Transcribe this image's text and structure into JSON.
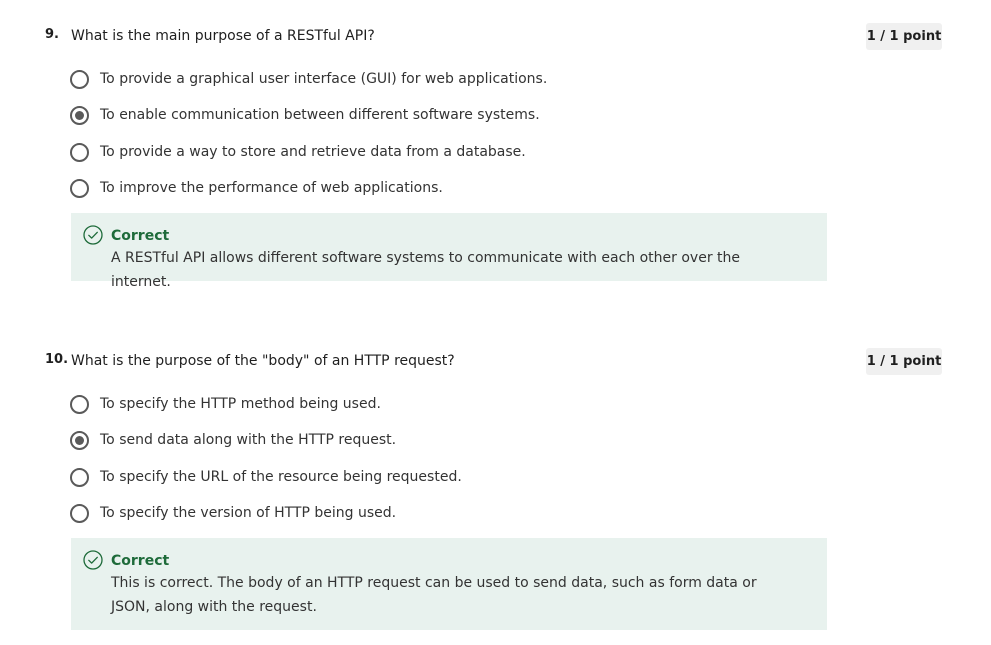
{
  "questions": [
    {
      "number": "9.",
      "text": "What is the main purpose of a RESTful API?",
      "points": "1 / 1 point",
      "options": [
        {
          "label": "To provide a graphical user interface (GUI) for web applications.",
          "selected": false
        },
        {
          "label": "To enable communication between different software systems.",
          "selected": true
        },
        {
          "label": "To provide a way to store and retrieve data from a database.",
          "selected": false
        },
        {
          "label": "To improve the performance of web applications.",
          "selected": false
        }
      ],
      "feedback": {
        "status": "Correct",
        "icon": "check-circle-icon",
        "text": "A RESTful API allows different software systems to communicate with each other over the internet."
      }
    },
    {
      "number": "10.",
      "text": "What is the purpose of the \"body\" of an HTTP request?",
      "points": "1 / 1 point",
      "options": [
        {
          "label": "To specify the HTTP method being used.",
          "selected": false
        },
        {
          "label": "To send data along with the HTTP request.",
          "selected": true
        },
        {
          "label": "To specify the URL of the resource being requested.",
          "selected": false
        },
        {
          "label": "To specify the version of HTTP being used.",
          "selected": false
        }
      ],
      "feedback": {
        "status": "Correct",
        "icon": "check-circle-icon",
        "text": "This is correct. The body of an HTTP request can be used to send data, such as form data or JSON, along with the request."
      }
    }
  ],
  "colors": {
    "feedback_background": "#e8f2ee",
    "correct_green": "#1e6b3a",
    "points_badge": "#f0f0f0",
    "radio": "#5a5a5a"
  }
}
